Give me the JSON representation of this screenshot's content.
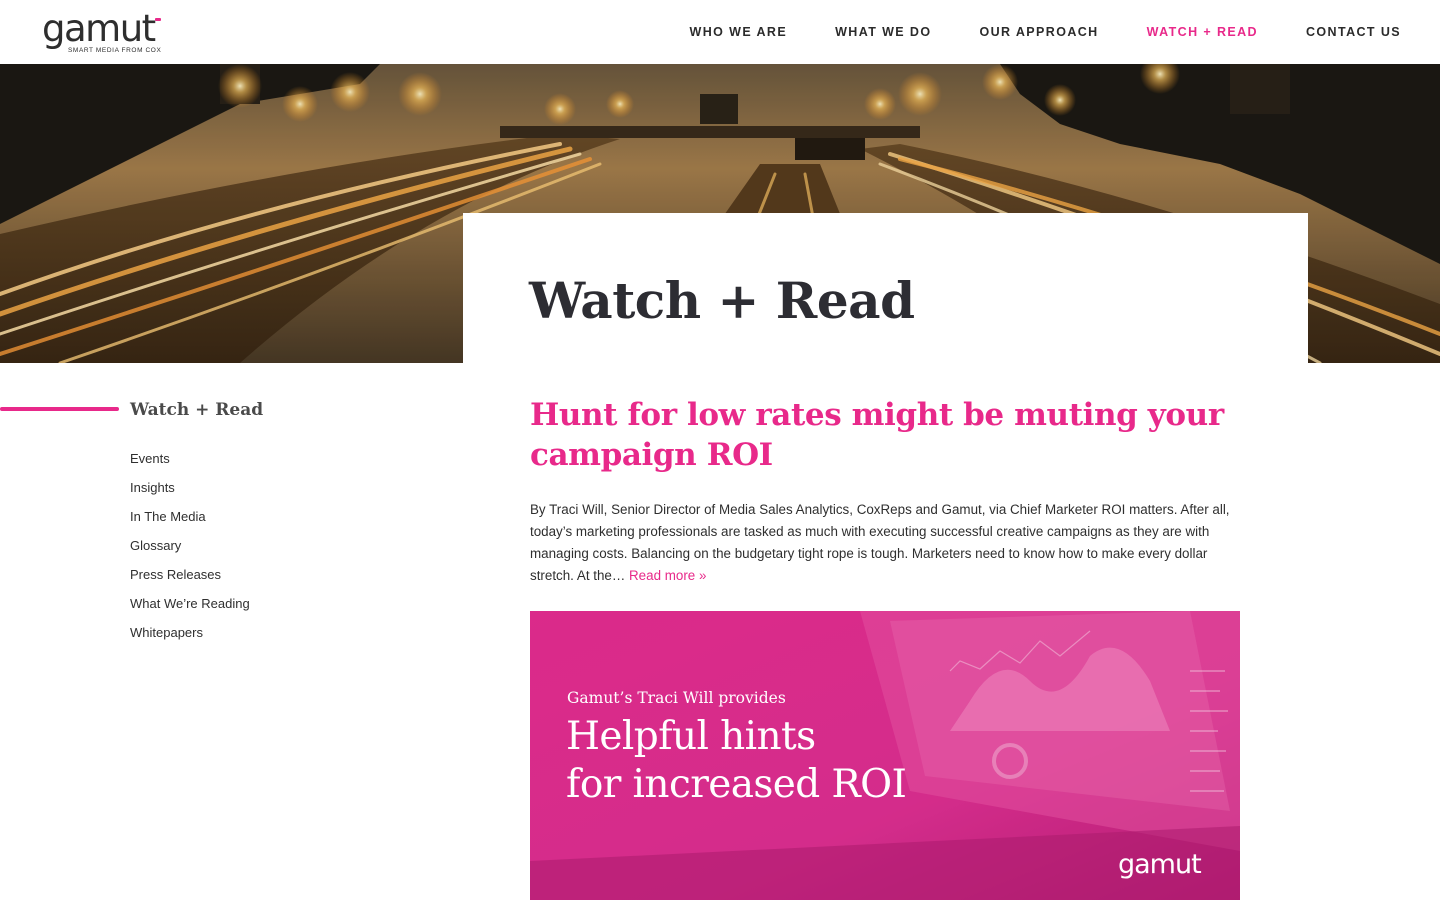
{
  "brand": {
    "logo_text": "gamut",
    "tagline": "SMART MEDIA FROM COX",
    "accent_color": "#e8298a"
  },
  "nav": {
    "items": [
      {
        "label": "WHO WE ARE"
      },
      {
        "label": "WHAT WE DO"
      },
      {
        "label": "OUR APPROACH"
      },
      {
        "label": "WATCH + READ"
      },
      {
        "label": "CONTACT US"
      }
    ],
    "active": "WATCH + READ"
  },
  "hero": {
    "title": "Watch + Read"
  },
  "sidebar": {
    "heading": "Watch + Read",
    "items": [
      {
        "label": "Events"
      },
      {
        "label": "Insights"
      },
      {
        "label": "In The Media"
      },
      {
        "label": "Glossary"
      },
      {
        "label": "Press Releases"
      },
      {
        "label": "What We’re Reading"
      },
      {
        "label": "Whitepapers"
      }
    ]
  },
  "article": {
    "title": "Hunt for low rates might be muting your campaign ROI",
    "excerpt": "By Traci Will, Senior Director of Media Sales Analytics, CoxReps and Gamut, via Chief Marketer ROI matters. After all, today’s marketing professionals are tasked as much with executing successful creative campaigns as they are with managing costs. Balancing on the budgetary tight rope is tough. Marketers need to know how to make every dollar stretch. At the…",
    "read_more": "Read more »"
  },
  "feature_image": {
    "subtitle": "Gamut’s Traci Will provides",
    "headline_line1": "Helpful hints",
    "headline_line2": "for increased ROI",
    "logo_text": "gamut"
  }
}
